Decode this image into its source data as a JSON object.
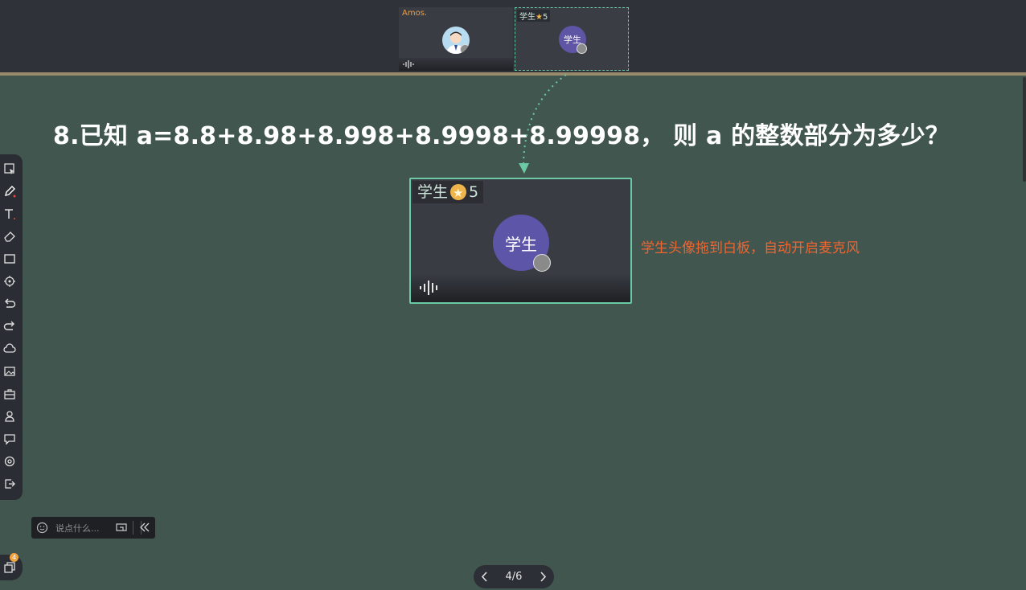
{
  "top_strip": {
    "teacher": {
      "name": "Amos."
    },
    "student": {
      "name": "学生",
      "stars": "5",
      "avatar_text": "学生"
    }
  },
  "question": {
    "text": "8.已知 a=8.8+8.98+8.998+8.9998+8.99998，  则 a 的整数部分为多少？"
  },
  "student_card": {
    "name": "学生",
    "stars": "5",
    "avatar_text": "学生"
  },
  "annotation": {
    "text": "学生头像拖到白板，自动开启麦克风"
  },
  "toolbar": {
    "tools": [
      "select-icon",
      "pen-icon",
      "text-icon",
      "eraser-icon",
      "rectangle-icon",
      "laser-pointer-icon",
      "undo-icon",
      "redo-icon",
      "cloud-upload-icon",
      "image-icon",
      "toolbox-icon",
      "user-icon",
      "chat-icon",
      "settings-icon",
      "exit-icon"
    ]
  },
  "chat": {
    "placeholder": "说点什么..."
  },
  "layers": {
    "badge": "4"
  },
  "pager": {
    "current": "4/6"
  },
  "colors": {
    "board": "#425650",
    "accent": "#6cc9a6",
    "annotation": "#ee6530",
    "teacher_name": "#e8a04a"
  }
}
